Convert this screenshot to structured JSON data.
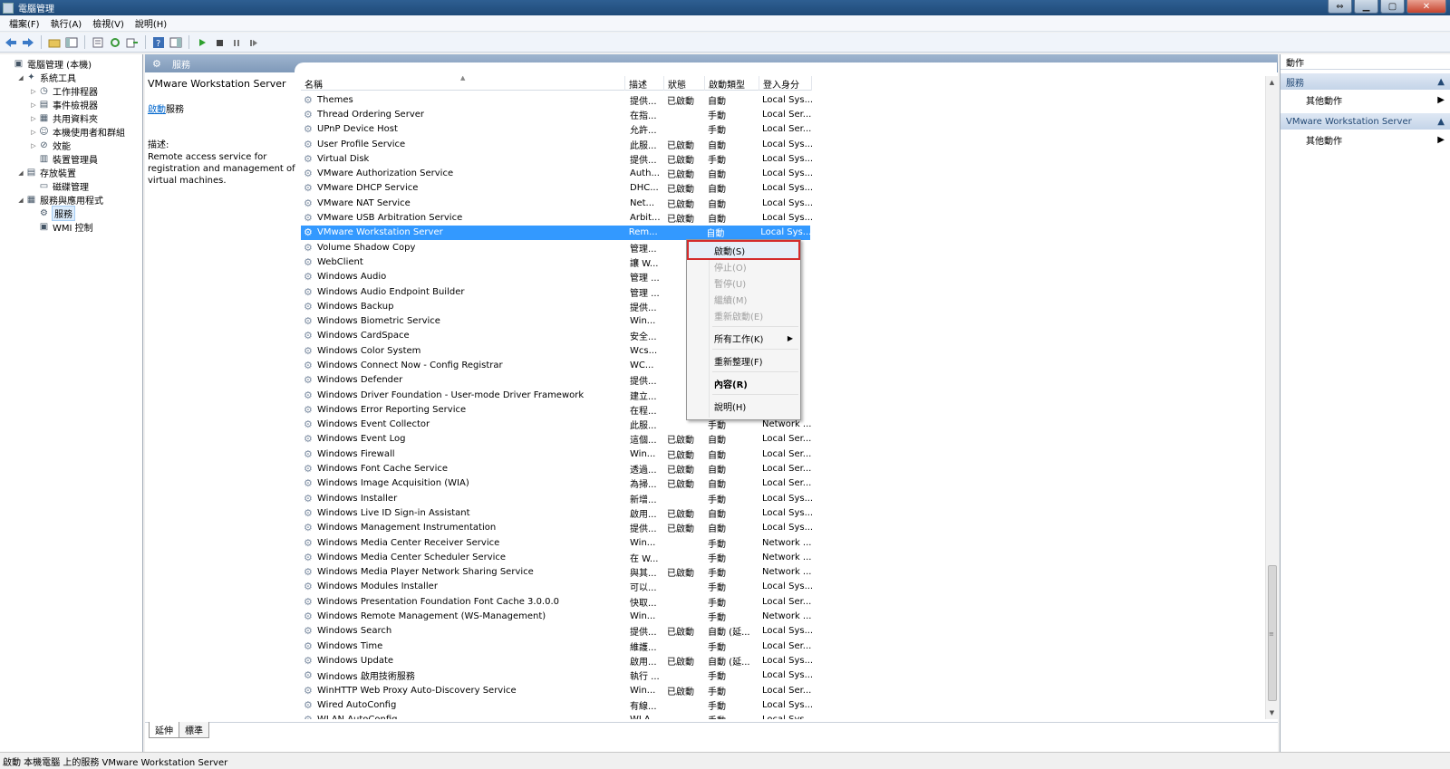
{
  "window": {
    "title": "電腦管理",
    "btn_resize": "⇔",
    "btn_min": "▁",
    "btn_max": "▢",
    "btn_close": "✕"
  },
  "menu": [
    "檔案(F)",
    "執行(A)",
    "檢視(V)",
    "說明(H)"
  ],
  "tree": [
    {
      "label": "電腦管理 (本機)",
      "level": 0,
      "exp": "",
      "icon": "computer-icon"
    },
    {
      "label": "系統工具",
      "level": 1,
      "exp": "◢",
      "icon": "tools-icon"
    },
    {
      "label": "工作排程器",
      "level": 2,
      "exp": "▷",
      "icon": "clock-icon"
    },
    {
      "label": "事件檢視器",
      "level": 2,
      "exp": "▷",
      "icon": "log-icon"
    },
    {
      "label": "共用資料夾",
      "level": 2,
      "exp": "▷",
      "icon": "folder-icon"
    },
    {
      "label": "本機使用者和群組",
      "level": 2,
      "exp": "▷",
      "icon": "users-icon"
    },
    {
      "label": "效能",
      "level": 2,
      "exp": "▷",
      "icon": "performance-icon"
    },
    {
      "label": "裝置管理員",
      "level": 2,
      "exp": "",
      "icon": "device-icon"
    },
    {
      "label": "存放裝置",
      "level": 1,
      "exp": "◢",
      "icon": "storage-icon"
    },
    {
      "label": "磁碟管理",
      "level": 2,
      "exp": "",
      "icon": "disk-icon"
    },
    {
      "label": "服務與應用程式",
      "level": 1,
      "exp": "◢",
      "icon": "apps-icon"
    },
    {
      "label": "服務",
      "level": 2,
      "exp": "",
      "icon": "gear-icon",
      "selected": true
    },
    {
      "label": "WMI 控制",
      "level": 2,
      "exp": "",
      "icon": "wmi-icon"
    }
  ],
  "center": {
    "header": "服務",
    "extended": {
      "service_name": "VMware Workstation Server",
      "start_link": "啟動",
      "start_suffix": "服務",
      "desc_label": "描述:",
      "desc_text": "Remote access service for registration and management of virtual machines."
    },
    "columns": [
      {
        "label": "名稱",
        "width": 358
      },
      {
        "label": "描述",
        "width": 43
      },
      {
        "label": "狀態",
        "width": 45
      },
      {
        "label": "啟動類型",
        "width": 60
      },
      {
        "label": "登入身分",
        "width": 58
      }
    ],
    "tabs": [
      "延伸",
      "標準"
    ]
  },
  "services": [
    {
      "name": "Themes",
      "desc": "提供...",
      "status": "已啟動",
      "start": "自動",
      "logon": "Local Sys..."
    },
    {
      "name": "Thread Ordering Server",
      "desc": "在指...",
      "status": "",
      "start": "手動",
      "logon": "Local Ser..."
    },
    {
      "name": "UPnP Device Host",
      "desc": "允許...",
      "status": "",
      "start": "手動",
      "logon": "Local Ser..."
    },
    {
      "name": "User Profile Service",
      "desc": "此服...",
      "status": "已啟動",
      "start": "自動",
      "logon": "Local Sys..."
    },
    {
      "name": "Virtual Disk",
      "desc": "提供...",
      "status": "已啟動",
      "start": "手動",
      "logon": "Local Sys..."
    },
    {
      "name": "VMware Authorization Service",
      "desc": "Auth...",
      "status": "已啟動",
      "start": "自動",
      "logon": "Local Sys..."
    },
    {
      "name": "VMware DHCP Service",
      "desc": "DHC...",
      "status": "已啟動",
      "start": "自動",
      "logon": "Local Sys..."
    },
    {
      "name": "VMware NAT Service",
      "desc": "Net...",
      "status": "已啟動",
      "start": "自動",
      "logon": "Local Sys..."
    },
    {
      "name": "VMware USB Arbitration Service",
      "desc": "Arbit...",
      "status": "已啟動",
      "start": "自動",
      "logon": "Local Sys..."
    },
    {
      "name": "VMware Workstation Server",
      "desc": "Rem...",
      "status": "",
      "start": "自動",
      "logon": "Local Sys...",
      "selected": true
    },
    {
      "name": "Volume Shadow Copy",
      "desc": "管理...",
      "status": "",
      "start": "",
      "logon": "Sys..."
    },
    {
      "name": "WebClient",
      "desc": "讓 W...",
      "status": "",
      "start": "",
      "logon": "Ser..."
    },
    {
      "name": "Windows Audio",
      "desc": "管理 ...",
      "status": "",
      "start": "",
      "logon": "Ser..."
    },
    {
      "name": "Windows Audio Endpoint Builder",
      "desc": "管理 ...",
      "status": "",
      "start": "",
      "logon": "Sys..."
    },
    {
      "name": "Windows Backup",
      "desc": "提供...",
      "status": "",
      "start": "",
      "logon": "Sys..."
    },
    {
      "name": "Windows Biometric Service",
      "desc": "Win...",
      "status": "",
      "start": "",
      "logon": "Sys..."
    },
    {
      "name": "Windows CardSpace",
      "desc": "安全...",
      "status": "",
      "start": "",
      "logon": "Sys..."
    },
    {
      "name": "Windows Color System",
      "desc": "Wcs...",
      "status": "",
      "start": "",
      "logon": "Ser..."
    },
    {
      "name": "Windows Connect Now - Config Registrar",
      "desc": "WC...",
      "status": "",
      "start": "",
      "logon": "Ser..."
    },
    {
      "name": "Windows Defender",
      "desc": "提供...",
      "status": "",
      "start": "",
      "logon": "Sys..."
    },
    {
      "name": "Windows Driver Foundation - User-mode Driver Framework",
      "desc": "建立...",
      "status": "",
      "start": "",
      "logon": "Sys..."
    },
    {
      "name": "Windows Error Reporting Service",
      "desc": "在程...",
      "status": "",
      "start": "",
      "logon": "Sys..."
    },
    {
      "name": "Windows Event Collector",
      "desc": "此服...",
      "status": "",
      "start": "手動",
      "logon": "Network ..."
    },
    {
      "name": "Windows Event Log",
      "desc": "這個...",
      "status": "已啟動",
      "start": "自動",
      "logon": "Local Ser..."
    },
    {
      "name": "Windows Firewall",
      "desc": "Win...",
      "status": "已啟動",
      "start": "自動",
      "logon": "Local Ser..."
    },
    {
      "name": "Windows Font Cache Service",
      "desc": "透過...",
      "status": "已啟動",
      "start": "自動",
      "logon": "Local Ser..."
    },
    {
      "name": "Windows Image Acquisition (WIA)",
      "desc": "為掃...",
      "status": "已啟動",
      "start": "自動",
      "logon": "Local Ser..."
    },
    {
      "name": "Windows Installer",
      "desc": "新增...",
      "status": "",
      "start": "手動",
      "logon": "Local Sys..."
    },
    {
      "name": "Windows Live ID Sign-in Assistant",
      "desc": "啟用...",
      "status": "已啟動",
      "start": "自動",
      "logon": "Local Sys..."
    },
    {
      "name": "Windows Management Instrumentation",
      "desc": "提供...",
      "status": "已啟動",
      "start": "自動",
      "logon": "Local Sys..."
    },
    {
      "name": "Windows Media Center Receiver Service",
      "desc": "Win...",
      "status": "",
      "start": "手動",
      "logon": "Network ..."
    },
    {
      "name": "Windows Media Center Scheduler Service",
      "desc": "在 W...",
      "status": "",
      "start": "手動",
      "logon": "Network ..."
    },
    {
      "name": "Windows Media Player Network Sharing Service",
      "desc": "與其...",
      "status": "已啟動",
      "start": "手動",
      "logon": "Network ..."
    },
    {
      "name": "Windows Modules Installer",
      "desc": "可以...",
      "status": "",
      "start": "手動",
      "logon": "Local Sys..."
    },
    {
      "name": "Windows Presentation Foundation Font Cache 3.0.0.0",
      "desc": "快取...",
      "status": "",
      "start": "手動",
      "logon": "Local Ser..."
    },
    {
      "name": "Windows Remote Management (WS-Management)",
      "desc": "Win...",
      "status": "",
      "start": "手動",
      "logon": "Network ..."
    },
    {
      "name": "Windows Search",
      "desc": "提供...",
      "status": "已啟動",
      "start": "自動 (延...",
      "logon": "Local Sys..."
    },
    {
      "name": "Windows Time",
      "desc": "維護...",
      "status": "",
      "start": "手動",
      "logon": "Local Ser..."
    },
    {
      "name": "Windows Update",
      "desc": "啟用...",
      "status": "已啟動",
      "start": "自動 (延...",
      "logon": "Local Sys..."
    },
    {
      "name": "Windows 啟用技術服務",
      "desc": "執行 ...",
      "status": "",
      "start": "手動",
      "logon": "Local Sys..."
    },
    {
      "name": "WinHTTP Web Proxy Auto-Discovery Service",
      "desc": "Win...",
      "status": "已啟動",
      "start": "手動",
      "logon": "Local Ser..."
    },
    {
      "name": "Wired AutoConfig",
      "desc": "有線...",
      "status": "",
      "start": "手動",
      "logon": "Local Sys..."
    },
    {
      "name": "WLAN AutoConfig",
      "desc": "WLA...",
      "status": "",
      "start": "手動",
      "logon": "Local Sys..."
    }
  ],
  "context_menu": [
    {
      "label": "啟動(S)",
      "disabled": false,
      "highlight": true
    },
    {
      "label": "停止(O)",
      "disabled": true
    },
    {
      "label": "暫停(U)",
      "disabled": true
    },
    {
      "label": "繼續(M)",
      "disabled": true
    },
    {
      "label": "重新啟動(E)",
      "disabled": true
    },
    {
      "sep": true
    },
    {
      "label": "所有工作(K)",
      "disabled": false,
      "submenu": true
    },
    {
      "sep": true
    },
    {
      "label": "重新整理(F)",
      "disabled": false
    },
    {
      "sep": true
    },
    {
      "label": "內容(R)",
      "disabled": false,
      "bold": true
    },
    {
      "sep": true
    },
    {
      "label": "說明(H)",
      "disabled": false
    }
  ],
  "actions": {
    "title": "動作",
    "sections": [
      {
        "header": "服務",
        "items": [
          "其他動作"
        ]
      },
      {
        "header": "VMware Workstation Server",
        "items": [
          "其他動作"
        ]
      }
    ]
  },
  "statusbar": "啟動 本機電腦 上的服務 VMware Workstation Server",
  "colors": {
    "selection": "#3399ff",
    "highlight_border": "#d42c2c",
    "titlebar": "#2e5f92"
  }
}
